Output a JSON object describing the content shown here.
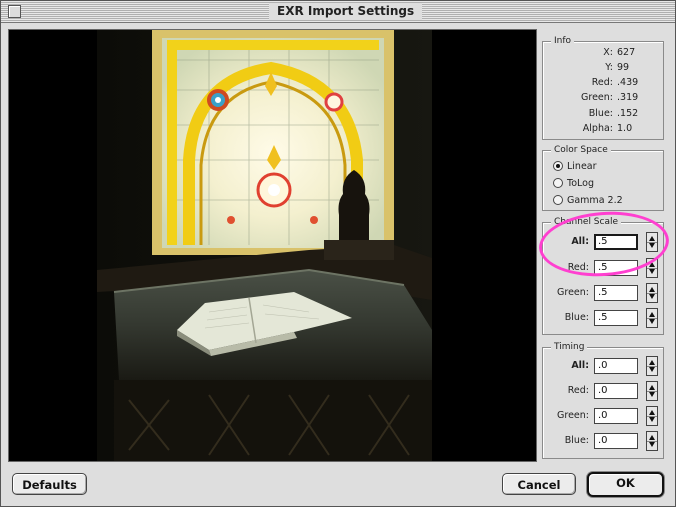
{
  "window": {
    "title": "EXR Import Settings"
  },
  "info": {
    "label": "Info",
    "rows": [
      {
        "key": "X:",
        "value": "627"
      },
      {
        "key": "Y:",
        "value": "99"
      },
      {
        "key": "Red:",
        "value": ".439"
      },
      {
        "key": "Green:",
        "value": ".319"
      },
      {
        "key": "Blue:",
        "value": ".152"
      },
      {
        "key": "Alpha:",
        "value": "1.0"
      }
    ]
  },
  "color_space": {
    "label": "Color Space",
    "options": [
      "Linear",
      "ToLog",
      "Gamma 2.2"
    ],
    "selected": "Linear"
  },
  "channel_scale": {
    "label": "Channel Scale",
    "fields": [
      {
        "label": "All:",
        "value": ".5"
      },
      {
        "label": "Red:",
        "value": ".5"
      },
      {
        "label": "Green:",
        "value": ".5"
      },
      {
        "label": "Blue:",
        "value": ".5"
      }
    ]
  },
  "timing": {
    "label": "Timing",
    "fields": [
      {
        "label": "All:",
        "value": ".0"
      },
      {
        "label": "Red:",
        "value": ".0"
      },
      {
        "label": "Green:",
        "value": ".0"
      },
      {
        "label": "Blue:",
        "value": ".0"
      }
    ]
  },
  "buttons": {
    "defaults": "Defaults",
    "cancel": "Cancel",
    "ok": "OK"
  },
  "colors": {
    "highlight_ring": "#ff3fd0",
    "dialog_bg": "#dedede"
  }
}
